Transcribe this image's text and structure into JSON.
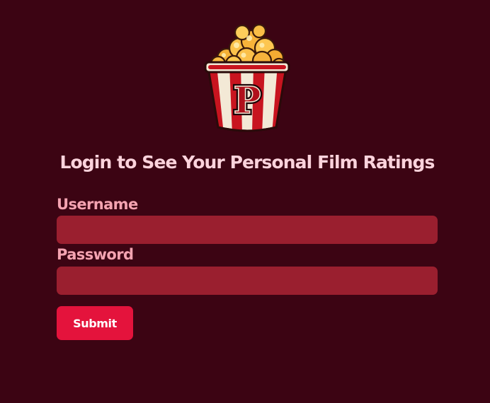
{
  "logo": {
    "icon": "popcorn-bucket-icon",
    "letter": "P"
  },
  "title": "Login to See Your Personal Film Ratings",
  "form": {
    "username_label": "Username",
    "username_value": "",
    "password_label": "Password",
    "password_value": "",
    "submit_label": "Submit"
  },
  "colors": {
    "background": "#3c0413",
    "title": "#fbd3dc",
    "label": "#f4a3b1",
    "input_fill": "#9a1f2f",
    "button": "#e4133c",
    "button_text": "#ffffff"
  }
}
